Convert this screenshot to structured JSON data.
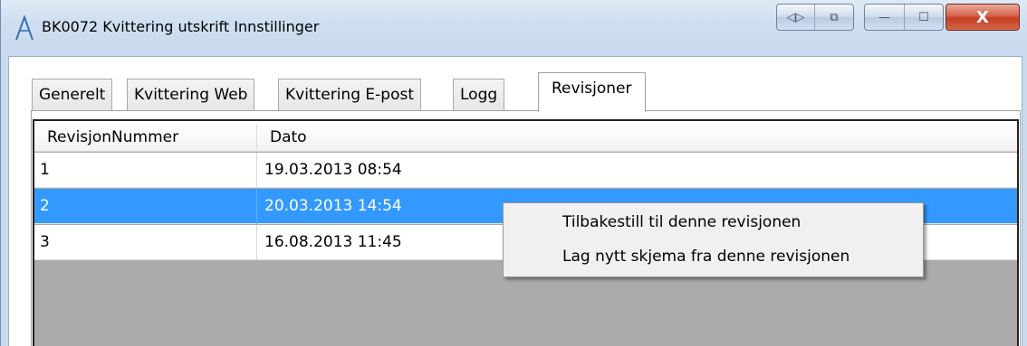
{
  "window": {
    "title": "BK0072 Kvittering utskrift Innstillinger",
    "caption_buttons": {
      "extra1": "◁▷",
      "extra2": "⧉",
      "minimize": "—",
      "maximize": "☐",
      "close": "X"
    }
  },
  "tabs": [
    {
      "label": "Generelt"
    },
    {
      "label": "Kvittering Web"
    },
    {
      "label": "Kvittering E-post"
    },
    {
      "label": "Logg"
    },
    {
      "label": "Revisjoner"
    }
  ],
  "active_tab": "Revisjoner",
  "grid": {
    "columns": [
      "RevisjonNummer",
      "Dato"
    ],
    "rows": [
      {
        "nummer": "1",
        "dato": "19.03.2013 08:54"
      },
      {
        "nummer": "2",
        "dato": "20.03.2013 14:54",
        "selected": true
      },
      {
        "nummer": "3",
        "dato": "16.08.2013 11:45"
      }
    ]
  },
  "context_menu": {
    "items": [
      {
        "label": "Tilbakestill til denne revisjonen"
      },
      {
        "label": "Lag nytt skjema fra denne revisjonen"
      }
    ]
  },
  "colors": {
    "selection": "#3399ff",
    "grid_empty": "#ababab",
    "close_button": "#c43d24"
  }
}
